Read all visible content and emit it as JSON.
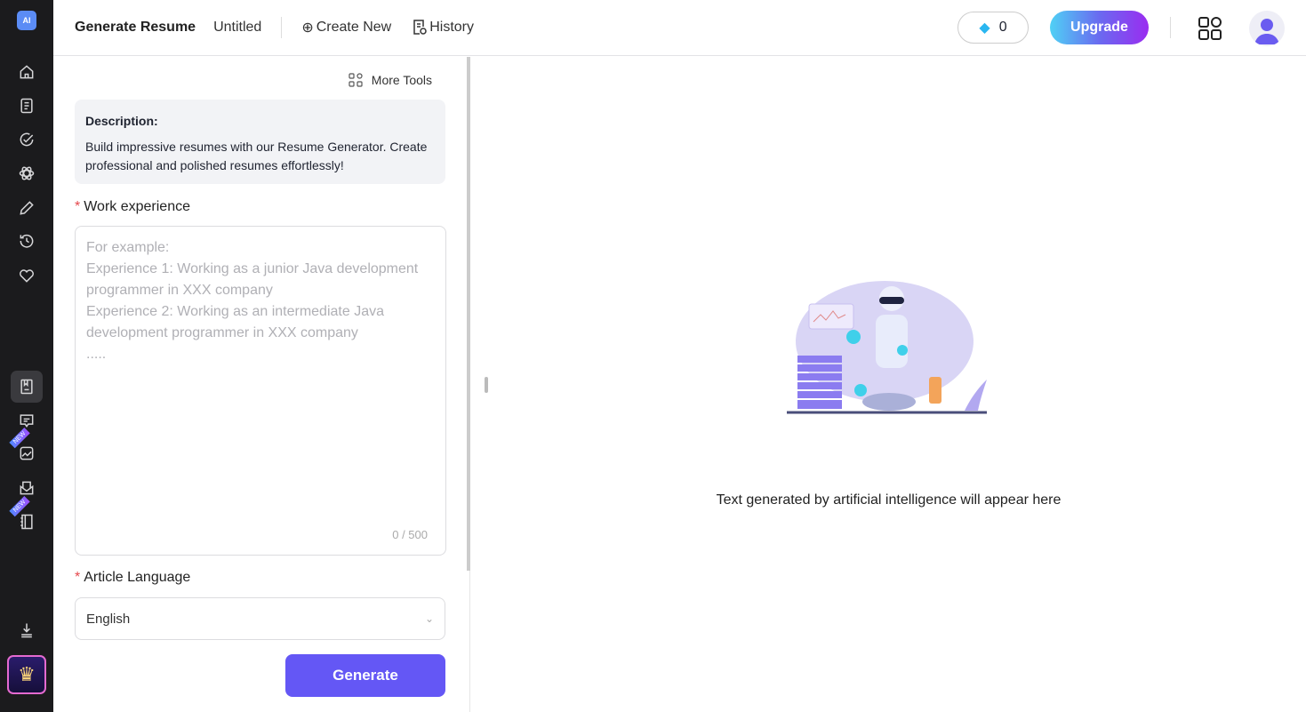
{
  "header": {
    "title": "Generate Resume",
    "doc_name": "Untitled",
    "create_new": "Create New",
    "history": "History",
    "credits": "0",
    "upgrade": "Upgrade"
  },
  "sidebar": {
    "logo": "AI",
    "items": [
      "home",
      "documents",
      "tasks",
      "atom",
      "edit",
      "history",
      "favorites",
      "resume",
      "chat",
      "image",
      "mail",
      "notebook",
      "download",
      "premium"
    ],
    "new_badge": "NEW"
  },
  "form": {
    "more_tools": "More Tools",
    "description_label": "Description:",
    "description_text": "Build impressive resumes with our Resume Generator. Create professional and polished resumes effortlessly!",
    "work_label": "Work experience",
    "work_placeholder": "For example:\nExperience 1: Working as a junior Java development programmer in XXX company\nExperience 2: Working as an intermediate Java development programmer in XXX company\n.....",
    "work_value": "",
    "count": "0 / 500",
    "language_label": "Article Language",
    "language_value": "English",
    "generate": "Generate",
    "required_mark": "*"
  },
  "output": {
    "placeholder": "Text generated by artificial intelligence will appear here"
  },
  "colors": {
    "accent": "#6457f5",
    "sidebar": "#1b1b1d",
    "required": "#e5484d"
  }
}
